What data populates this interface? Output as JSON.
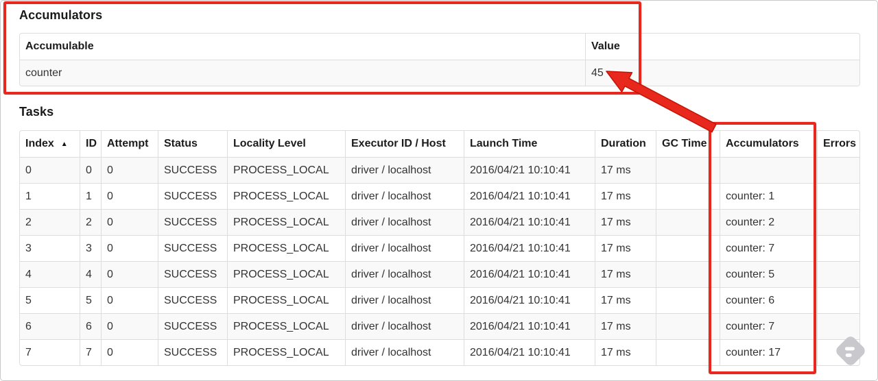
{
  "annotations": {
    "highlight_color": "#e8271d"
  },
  "accumulators_section": {
    "title": "Accumulators",
    "table": {
      "col_accumulable": "Accumulable",
      "col_value": "Value",
      "rows": [
        {
          "accumulable": "counter",
          "value": "45"
        }
      ]
    }
  },
  "tasks_section": {
    "title": "Tasks",
    "table": {
      "headers": {
        "index": "Index",
        "id": "ID",
        "attempt": "Attempt",
        "status": "Status",
        "locality": "Locality Level",
        "executor": "Executor ID / Host",
        "launch": "Launch Time",
        "duration": "Duration",
        "gc": "GC Time",
        "accumulators": "Accumulators",
        "errors": "Errors"
      },
      "sort_indicator": "▲",
      "rows": [
        {
          "index": "0",
          "id": "0",
          "attempt": "0",
          "status": "SUCCESS",
          "locality": "PROCESS_LOCAL",
          "executor": "driver / localhost",
          "launch": "2016/04/21 10:10:41",
          "duration": "17 ms",
          "gc": "",
          "accumulators": "",
          "errors": ""
        },
        {
          "index": "1",
          "id": "1",
          "attempt": "0",
          "status": "SUCCESS",
          "locality": "PROCESS_LOCAL",
          "executor": "driver / localhost",
          "launch": "2016/04/21 10:10:41",
          "duration": "17 ms",
          "gc": "",
          "accumulators": "counter: 1",
          "errors": ""
        },
        {
          "index": "2",
          "id": "2",
          "attempt": "0",
          "status": "SUCCESS",
          "locality": "PROCESS_LOCAL",
          "executor": "driver / localhost",
          "launch": "2016/04/21 10:10:41",
          "duration": "17 ms",
          "gc": "",
          "accumulators": "counter: 2",
          "errors": ""
        },
        {
          "index": "3",
          "id": "3",
          "attempt": "0",
          "status": "SUCCESS",
          "locality": "PROCESS_LOCAL",
          "executor": "driver / localhost",
          "launch": "2016/04/21 10:10:41",
          "duration": "17 ms",
          "gc": "",
          "accumulators": "counter: 7",
          "errors": ""
        },
        {
          "index": "4",
          "id": "4",
          "attempt": "0",
          "status": "SUCCESS",
          "locality": "PROCESS_LOCAL",
          "executor": "driver / localhost",
          "launch": "2016/04/21 10:10:41",
          "duration": "17 ms",
          "gc": "",
          "accumulators": "counter: 5",
          "errors": ""
        },
        {
          "index": "5",
          "id": "5",
          "attempt": "0",
          "status": "SUCCESS",
          "locality": "PROCESS_LOCAL",
          "executor": "driver / localhost",
          "launch": "2016/04/21 10:10:41",
          "duration": "17 ms",
          "gc": "",
          "accumulators": "counter: 6",
          "errors": ""
        },
        {
          "index": "6",
          "id": "6",
          "attempt": "0",
          "status": "SUCCESS",
          "locality": "PROCESS_LOCAL",
          "executor": "driver / localhost",
          "launch": "2016/04/21 10:10:41",
          "duration": "17 ms",
          "gc": "",
          "accumulators": "counter: 7",
          "errors": ""
        },
        {
          "index": "7",
          "id": "7",
          "attempt": "0",
          "status": "SUCCESS",
          "locality": "PROCESS_LOCAL",
          "executor": "driver / localhost",
          "launch": "2016/04/21 10:10:41",
          "duration": "17 ms",
          "gc": "",
          "accumulators": "counter: 17",
          "errors": ""
        }
      ]
    }
  },
  "watermark": {
    "icon": "feedly-logo",
    "color": "#c9c9cd"
  }
}
